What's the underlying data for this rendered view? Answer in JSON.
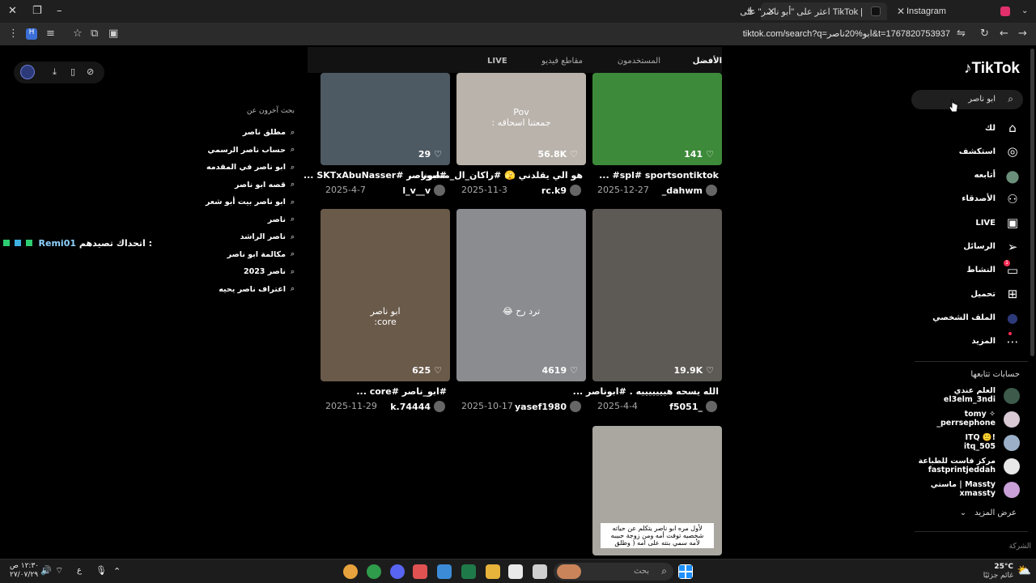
{
  "browser": {
    "tabs": [
      {
        "title": "Instagram",
        "favicon_color": "#e1306c"
      },
      {
        "title": "اعثر على \"أبو ناصر\" على TikTok |",
        "favicon_color": "#111111"
      }
    ],
    "new_tab": "+",
    "url": "tiktok.com/search?q=ابو%20ناصر&t=1767820753937"
  },
  "tiktok": {
    "logo": "TikTok",
    "search_value": "ابو ناصر",
    "tabs": [
      "الأفضل",
      "المستخدمون",
      "مقاطع فيديو",
      "LIVE"
    ],
    "nav": [
      {
        "label": "لك",
        "icon": "home-icon"
      },
      {
        "label": "استكشف",
        "icon": "compass-icon"
      },
      {
        "label": "أتابعه",
        "icon": "following-avatar-icon"
      },
      {
        "label": "الأصدقاء",
        "icon": "friends-icon"
      },
      {
        "label": "LIVE",
        "icon": "live-icon"
      },
      {
        "label": "الرسائل",
        "icon": "messages-icon"
      },
      {
        "label": "النشاط",
        "icon": "activity-icon",
        "badge": "1"
      },
      {
        "label": "تحميل",
        "icon": "upload-icon"
      },
      {
        "label": "الملف الشخصي",
        "icon": "profile-icon"
      },
      {
        "label": "المزيد",
        "icon": "more-icon"
      }
    ],
    "following_title": "حسابات تتابعها",
    "accounts": [
      {
        "name": "العلم عندي",
        "user": "el3elm_3ndi",
        "color": "#3d5a4a"
      },
      {
        "name": "tomy ✧",
        "user": "_perrsephone",
        "color": "#d8c9d4"
      },
      {
        "name": "ITQ 🙂!",
        "user": "itq_505",
        "color": "#9bb0c8"
      },
      {
        "name": "مركز فاست للطباعة",
        "user": "fastprintjeddah",
        "color": "#e8e8e8"
      },
      {
        "name": "ماستي | Massty",
        "user": "xmassty",
        "color": "#c9a0d8"
      }
    ],
    "see_more": "عرض المزيد",
    "company": "الشركة",
    "others_title": "بحث آخرون عن",
    "others": [
      "مطلق ناصر",
      "حساب ناصر الرسمي",
      "ابو ناصر في المقدمه",
      "قصه ابو ناصر",
      "ابو ناصر بيت أبو شعر",
      "ناصر",
      "ناصر الراشد",
      "مكالمة ابو ناصر",
      "ناصر 2023",
      "اعتراف ناصر يحيه"
    ],
    "challenge": {
      "text": "اتحداك تصيدهم :",
      "name": "Remi01"
    },
    "videos": [
      {
        "likes": "141",
        "caption": "spl# sportsontiktok# ...",
        "date": "2025-12-27",
        "user": "_dahwm",
        "thumb": "#3d8a3a"
      },
      {
        "likes": "56.8K",
        "caption": "هو الي يقلدني 🫣 #راكان_ال_منصور ...",
        "date": "2025-11-3",
        "user": "rc.k9",
        "thumb": "#b9b3ab",
        "overlay": "Pov\nجمعتنا اسحاقه :"
      },
      {
        "likes": "29",
        "caption": "#ابوناصر #SKTxAbuNasser ...",
        "date": "2025-4-7",
        "user": "l_v__v",
        "thumb": "#4e5a63"
      },
      {
        "likes": "19.9K",
        "caption": "الله يسحه هيييييييه . #ابوناصر ...",
        "date": "2025-4-4",
        "user": "f5051_",
        "thumb": "#5d5a55"
      },
      {
        "likes": "4619",
        "caption": "",
        "date": "2025-10-17",
        "user": "yasef1980",
        "thumb": "#8a8c90",
        "overlay": "ترد رح 😂"
      },
      {
        "likes": "625",
        "caption": "#ابو_ناصر #core ...",
        "date": "2025-11-29",
        "user": "k.74444",
        "thumb": "#6a5a4a",
        "overlay": "ابو ناصر\ncore:"
      },
      {
        "likes": "",
        "caption": "",
        "date": "",
        "user": "",
        "thumb": "#a9a7a0",
        "overlay": "لأول مره ابو ناصر يتكلم عن حياته\nشخصيه توفت أمه ومن زوجة حبيبه\nلأمه سمي بنته على امه ( وطلق"
      }
    ]
  },
  "taskbar": {
    "search_placeholder": "بحث",
    "weather_temp": "25°C",
    "weather_desc": "غائم جزئيًا",
    "time": "١٢:٣٠ ص",
    "date": "٢٧/٠٧/٢٩",
    "lang": "ع"
  }
}
